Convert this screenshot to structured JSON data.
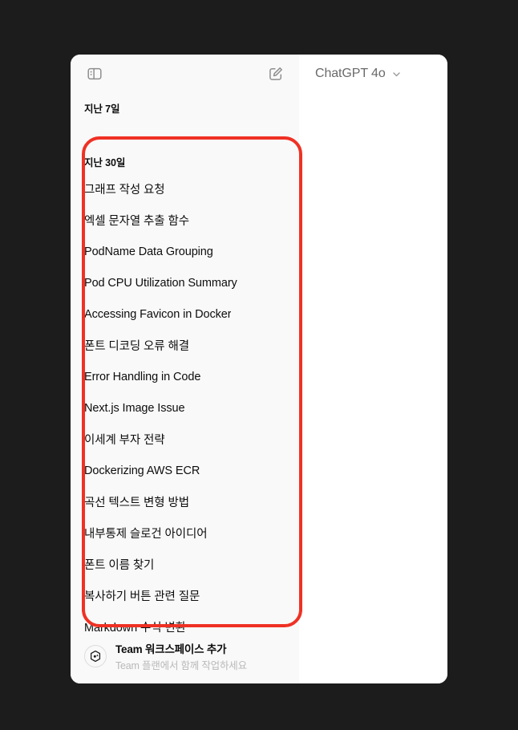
{
  "window": {
    "backdrop_color": "#1c1c1c",
    "sidebar_bg": "#f9f9f9",
    "main_bg": "#ffffff"
  },
  "sidebar": {
    "toggle_icon": "sidebar-toggle-icon",
    "new_chat_icon": "new-chat-pencil-icon",
    "groups": [
      {
        "header": "지난 7일",
        "items": []
      },
      {
        "header": "지난 30일",
        "items": [
          "그래프 작성 요청",
          "엑셀 문자열 추출 함수",
          "PodName Data Grouping",
          "Pod CPU Utilization Summary",
          "Accessing Favicon in Docker",
          "폰트 디코딩 오류 해결",
          "Error Handling in Code",
          "Next.js Image Issue",
          "이세계 부자 전략",
          "Dockerizing AWS ECR",
          "곡선 텍스트 변형 방법",
          "내부통제 슬로건 아이디어",
          "폰트 이름 찾기",
          "복사하기 버튼 관련 질문",
          "Markdown 수식 변환"
        ]
      }
    ],
    "footer": {
      "icon": "workspace-hexagon-icon",
      "title": "Team 워크스페이스 추가",
      "subtitle": "Team 플랜에서 함께 작업하세요"
    }
  },
  "main": {
    "model_label": "ChatGPT 4o",
    "model_chevron_icon": "chevron-down-icon"
  },
  "annotation": {
    "shape": "rounded-rectangle",
    "color": "#ef3124"
  }
}
